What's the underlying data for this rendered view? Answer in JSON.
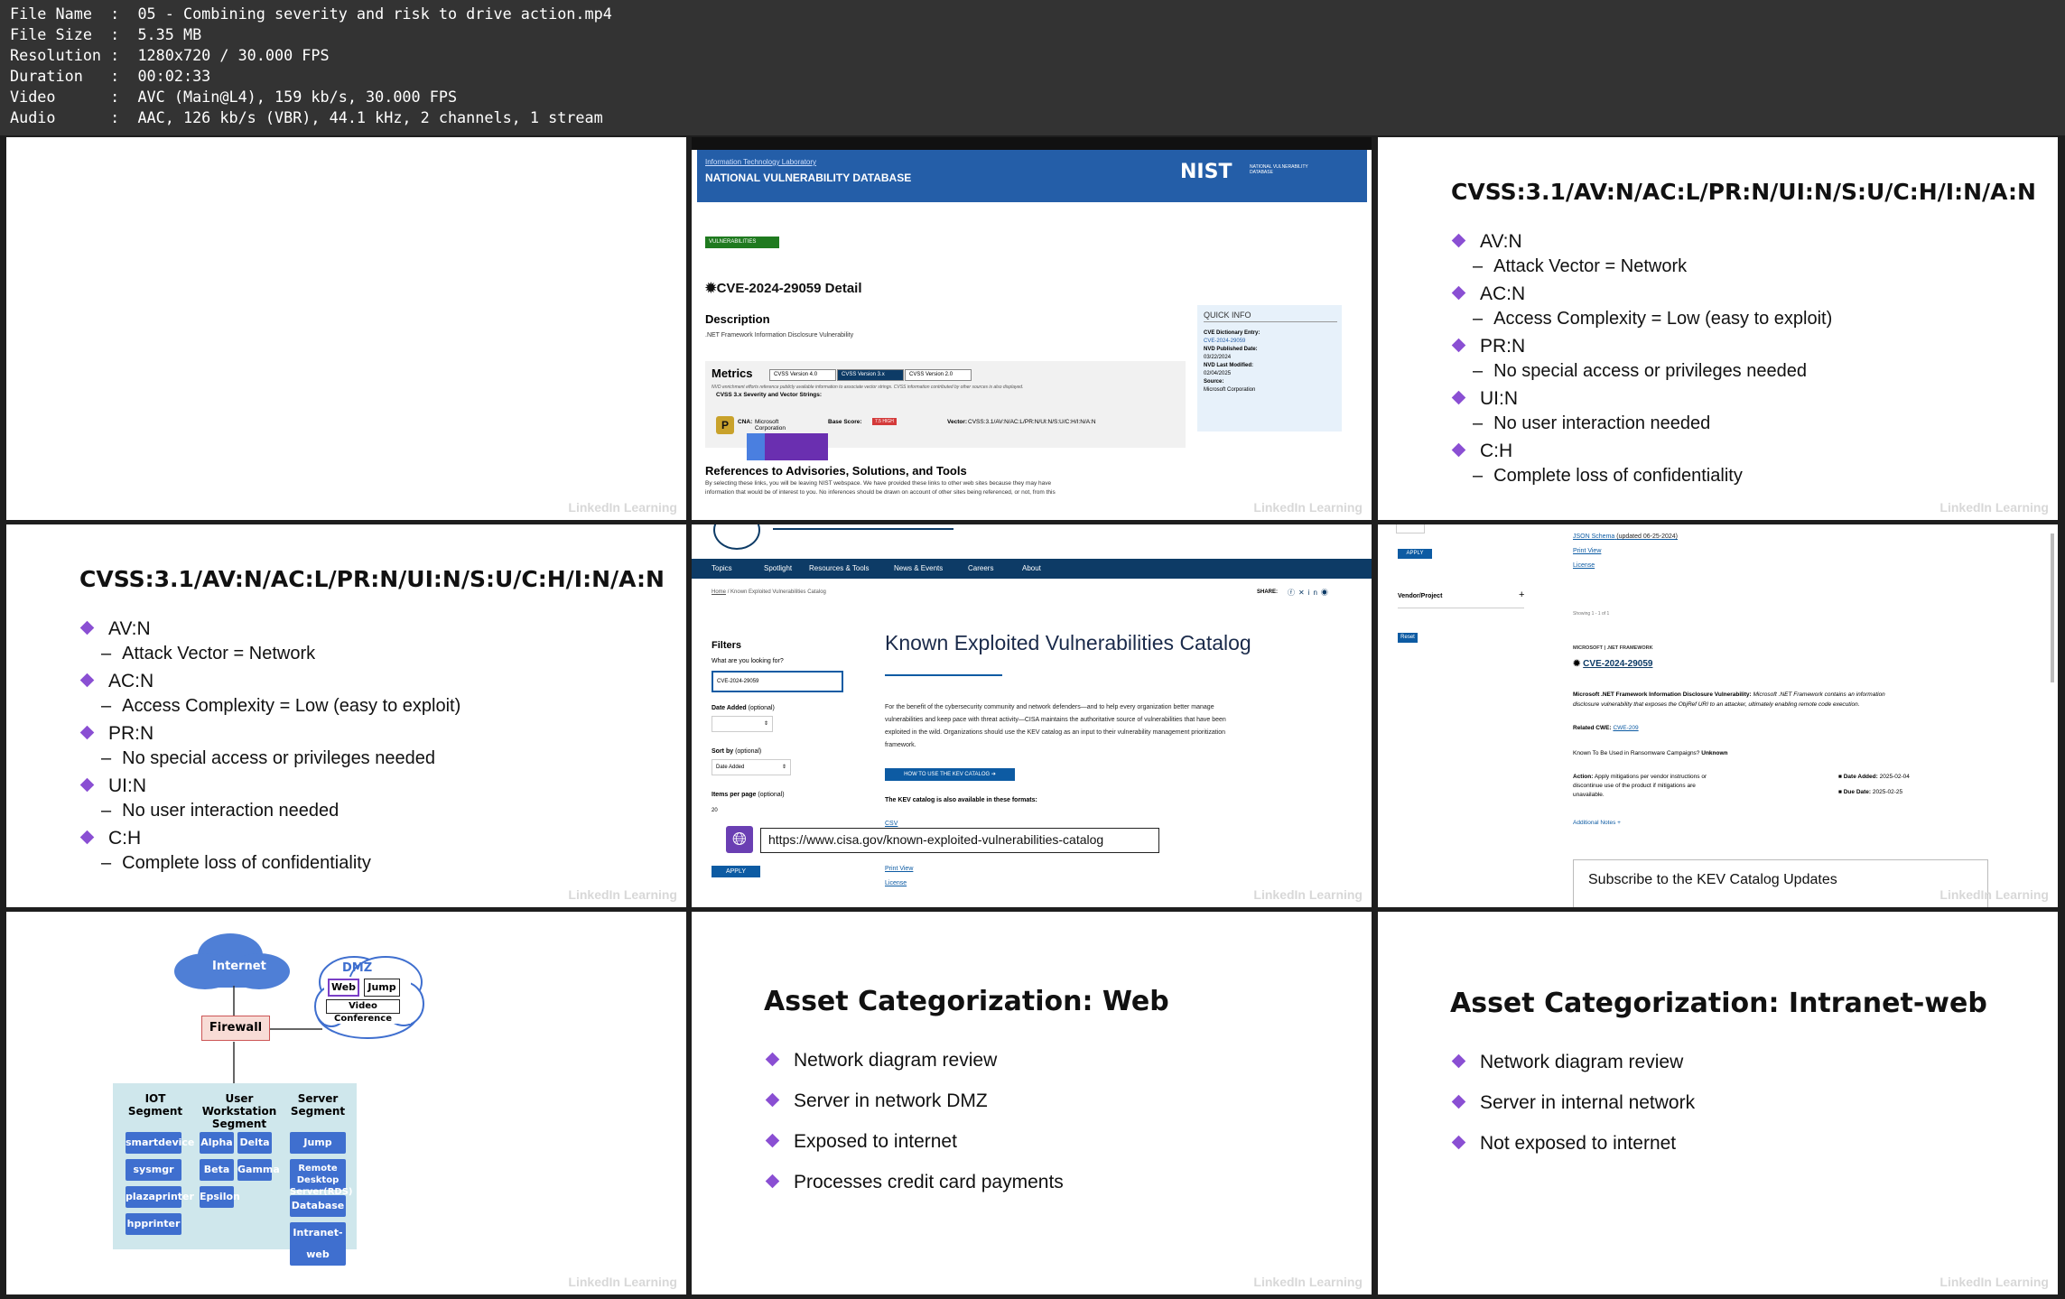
{
  "info": {
    "file_name": "File Name  :  05 - Combining severity and risk to drive action.mp4",
    "file_size": "File Size  :  5.35 MB",
    "resolution": "Resolution :  1280x720 / 30.000 FPS",
    "duration": "Duration   :  00:02:33",
    "video": "Video      :  AVC (Main@L4), 159 kb/s, 30.000 FPS",
    "audio": "Audio      :  AAC, 126 kb/s (VBR), 44.1 kHz, 2 channels, 1 stream"
  },
  "watermark": "LinkedIn Learning",
  "nvd": {
    "itl": "Information Technology Laboratory",
    "title": "NATIONAL VULNERABILITY DATABASE",
    "logo": "NIST",
    "logo_sub": "NATIONAL VULNERABILITY DATABASE",
    "badge": "VULNERABILITIES",
    "cve_title": "CVE-2024-29059 Detail",
    "description_h": "Description",
    "description": ".NET Framework Information Disclosure Vulnerability",
    "metrics_h": "Metrics",
    "tabs": [
      "CVSS Version 4.0",
      "CVSS Version 3.x",
      "CVSS Version 2.0"
    ],
    "nvd_note": "NVD enrichment efforts reference publicly available information to associate vector strings. CVSS information contributed by other sources is also displayed.",
    "sev_h": "CVSS 3.x Severity and Vector Strings:",
    "cna": "CNA:",
    "cna_val": "Microsoft Corporation",
    "base_score": "Base Score:",
    "base_badge": "7.5 HIGH",
    "vector": "Vector:",
    "vector_val": "CVSS:3.1/AV:N/AC:L/PR:N/UI:N/S:U/C:H/I:N/A:N",
    "refs_h": "References to Advisories, Solutions, and Tools",
    "refs_text1": "By selecting these links, you will be leaving NIST webspace. We have provided these links to other web sites because they may have",
    "refs_text2": "information that would be of interest to you. No inferences should be drawn on account of other sites being referenced, or not, from this",
    "quick_info": "QUICK INFO",
    "qi_dict": "CVE Dictionary Entry:",
    "qi_dict_val": "CVE-2024-29059",
    "qi_pub": "NVD Published Date:",
    "qi_pub_val": "03/22/2024",
    "qi_mod": "NVD Last Modified:",
    "qi_mod_val": "02/04/2025",
    "qi_src": "Source:",
    "qi_src_val": "Microsoft Corporation"
  },
  "cvss": {
    "title": "CVSS:3.1/AV:N/AC:L/PR:N/UI:N/S:U/C:H/I:N/A:N",
    "items": [
      {
        "k": "AV:N",
        "v": "Attack Vector = Network"
      },
      {
        "k": "AC:N",
        "v": "Access Complexity = Low (easy to exploit)"
      },
      {
        "k": "PR:N",
        "v": "No special access or privileges needed"
      },
      {
        "k": "UI:N",
        "v": "No user interaction needed"
      },
      {
        "k": "C:H",
        "v": "Complete loss of confidentiality"
      }
    ]
  },
  "cisa": {
    "nav": [
      "Topics",
      "Spotlight",
      "Resources & Tools",
      "News & Events",
      "Careers",
      "About"
    ],
    "breadcrumb_home": "Home",
    "breadcrumb_sep": "/",
    "breadcrumb_cur": "Known Exploited Vulnerabilities Catalog",
    "share": "SHARE:",
    "filters": "Filters",
    "what_looking": "What are you looking for?",
    "search_val": "CVE-2024-29059",
    "date_added": "Date Added",
    "optional": "(optional)",
    "sort_by": "Sort by",
    "sort_val": "Date Added",
    "items_per_page": "Items per page",
    "ipp_val": "20",
    "apply": "APPLY",
    "title": "Known Exploited Vulnerabilities Catalog",
    "body1": "For the benefit of the cybersecurity community and network defenders—and to help every organization better manage",
    "body2": "vulnerabilities and keep pace with threat activity—CISA maintains the authoritative source of vulnerabilities that have been",
    "body3": "exploited in the wild. Organizations should use the KEV catalog as an input to their vulnerability management prioritization",
    "body4": "framework.",
    "how_btn": "HOW TO USE THE KEV CATALOG",
    "formats": "The KEV catalog is also available in these formats:",
    "url": "https://www.cisa.gov/known-exploited-vulnerabilities-catalog",
    "link_csv": "CSV",
    "link_json": "JSON Schema",
    "link_json_suffix": "(updated 06-25-2024)",
    "link_print": "Print View",
    "link_license": "License"
  },
  "kev": {
    "apply": "APPLY",
    "vendor_project": "Vendor/Project",
    "plus": "+",
    "reset": "Reset",
    "showing": "Showing 1 - 1 of 1",
    "vendor_line": "MICROSOFT | .NET FRAMEWORK",
    "cve_link": "CVE-2024-29059",
    "vuln_name": "Microsoft .NET Framework Information Disclosure Vulnerability:",
    "vuln_desc1": "Microsoft .NET Framework contains an information",
    "vuln_desc2": "disclosure vulnerability that exposes the ObjRef URI to an attacker, ultimately enabling remote code execution.",
    "related_cwe": "Related CWE:",
    "cwe_link": "CWE-209",
    "ransomware": "Known To Be Used in Ransomware Campaigns?",
    "ransomware_val": "Unknown",
    "action": "Action:",
    "action_text1": "Apply mitigations per vendor instructions or",
    "action_text2": "discontinue use of the product if mitigations are",
    "action_text3": "unavailable.",
    "date_added": "Date Added:",
    "date_added_val": "2025-02-04",
    "due_date": "Due Date:",
    "due_date_val": "2025-02-25",
    "additional": "Additional Notes +",
    "subscribe": "Subscribe to the KEV Catalog Updates"
  },
  "diagram": {
    "internet": "Internet",
    "firewall": "Firewall",
    "dmz": "DMZ",
    "web": "Web",
    "jump": "Jump",
    "video_conf": "Video Conference",
    "iot_seg": "IOT Segment",
    "user_seg": "User Workstation Segment",
    "server_seg": "Server Segment",
    "iot": [
      "smartdevice",
      "sysmgr",
      "plazaprinter",
      "hpprinter"
    ],
    "user_left": [
      "Alpha",
      "Beta",
      "Epsilon"
    ],
    "user_right": [
      "Delta",
      "Gamma"
    ],
    "server": [
      "Jump",
      "Remote Desktop Server(RDS)",
      "Database",
      "Intranet-web"
    ]
  },
  "web_slide": {
    "title": "Asset Categorization: Web",
    "items": [
      "Network diagram review",
      "Server in network DMZ",
      "Exposed to internet",
      "Processes credit card payments"
    ]
  },
  "intranet_slide": {
    "title": "Asset Categorization: Intranet-web",
    "items": [
      "Network diagram review",
      "Server in internal network",
      "Not exposed to internet"
    ]
  },
  "colors": {
    "accent": "#8a4fd3",
    "nvd_blue": "#245ea8",
    "cisa_navy": "#0d3b66",
    "diagram_blue": "#3f6fcf",
    "firewall": "#f8dcd6",
    "segment_bg": "#cfe7ec"
  }
}
